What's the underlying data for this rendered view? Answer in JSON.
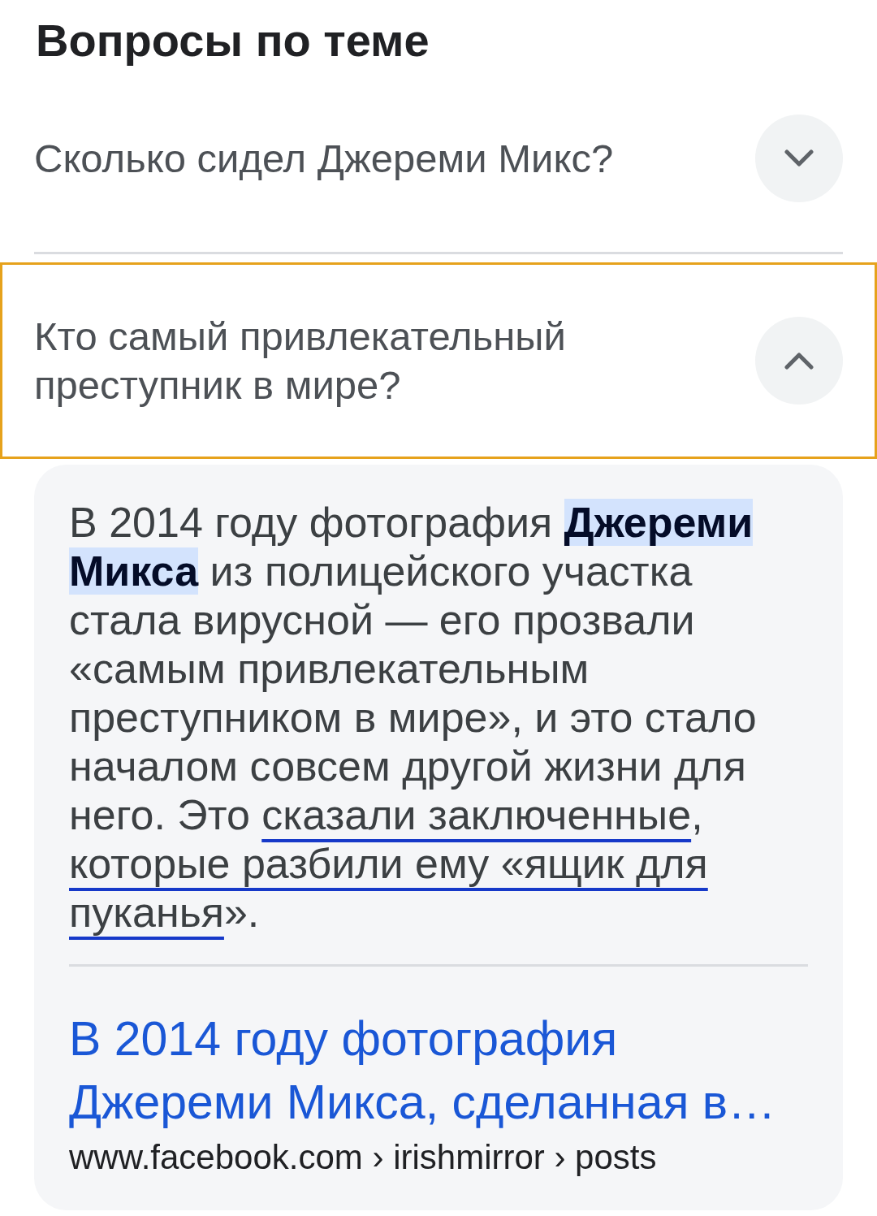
{
  "section": {
    "title": "Вопросы по теме"
  },
  "questions": [
    {
      "text": "Сколько сидел Джереми Микс?",
      "expanded": false,
      "focused": false
    },
    {
      "text": "Кто самый привлекательный преступник в мире?",
      "expanded": true,
      "focused": true,
      "answer": {
        "segments": [
          {
            "kind": "plain",
            "text": "В 2014 году фотография "
          },
          {
            "kind": "highlight",
            "text": "Джереми Микса"
          },
          {
            "kind": "plain",
            "text": " из полицейского участка стала вирусной — его прозвали «самым привлекательным преступником в мире», и это стало началом совсем другой жизни для него. Это "
          },
          {
            "kind": "scribbled",
            "text": "сказали заключенные"
          },
          {
            "kind": "plain",
            "text": ", "
          },
          {
            "kind": "scribbled",
            "text": "которые разбили ему «ящик для пуканья"
          },
          {
            "kind": "plain",
            "text": "»."
          }
        ],
        "source": {
          "title": "В 2014 году фотография Джереми Микса, сделанная в…",
          "url": "www.facebook.com › irishmirror › posts"
        }
      }
    }
  ]
}
